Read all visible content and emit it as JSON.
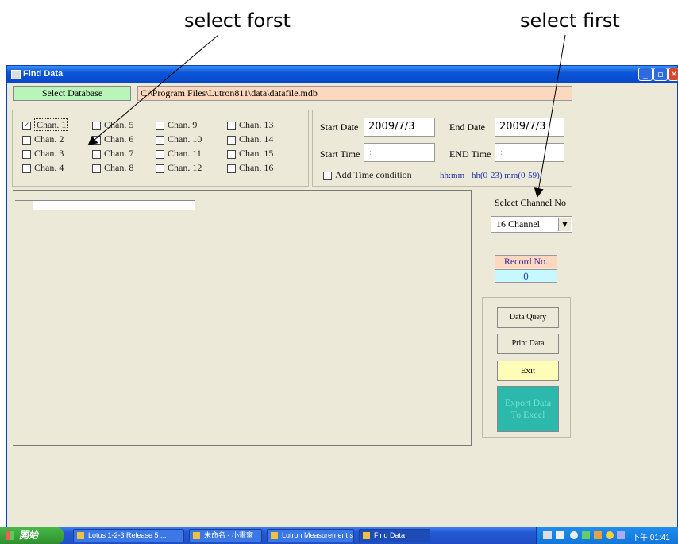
{
  "annotations": {
    "left": "select forst",
    "right": "select first"
  },
  "window": {
    "title": "Find Data",
    "controls": {
      "minimize": "_",
      "maximize": "▫",
      "close": "✕"
    }
  },
  "database": {
    "button_label": "Select Database",
    "path": "C:\\Program Files\\Lutron811\\data\\datafile.mdb"
  },
  "channels": [
    {
      "label": "Chan. 1",
      "checked": true
    },
    {
      "label": "Chan. 2",
      "checked": false
    },
    {
      "label": "Chan. 3",
      "checked": false
    },
    {
      "label": "Chan. 4",
      "checked": false
    },
    {
      "label": "Chan. 5",
      "checked": false
    },
    {
      "label": "Chan. 6",
      "checked": false
    },
    {
      "label": "Chan. 7",
      "checked": false
    },
    {
      "label": "Chan. 8",
      "checked": false
    },
    {
      "label": "Chan. 9",
      "checked": false
    },
    {
      "label": "Chan. 10",
      "checked": false
    },
    {
      "label": "Chan. 11",
      "checked": false
    },
    {
      "label": "Chan. 12",
      "checked": false
    },
    {
      "label": "Chan. 13",
      "checked": false
    },
    {
      "label": "Chan. 14",
      "checked": false
    },
    {
      "label": "Chan. 15",
      "checked": false
    },
    {
      "label": "Chan. 16",
      "checked": false
    }
  ],
  "dates": {
    "start_label": "Start Date",
    "start_value": "2009/7/3",
    "end_label": "End Date",
    "end_value": "2009/7/3",
    "start_time_label": "Start Time",
    "start_time_value": " :",
    "end_time_label": "END Time",
    "end_time_value": " :",
    "add_time_label": "Add Time condition",
    "hint1": "hh:mm",
    "hint2": "hh(0-23) mm(0-59)"
  },
  "select_channel": {
    "label": "Select Channel No",
    "value": "16 Channel"
  },
  "record": {
    "label": "Record No.",
    "value": "0"
  },
  "buttons": {
    "query": "Data Query",
    "print": "Print Data",
    "exit": "Exit",
    "export_line1": "Export Data",
    "export_line2": "To Excel"
  },
  "taskbar": {
    "start": "開始",
    "tasks": [
      "Lotus 1-2-3 Release 5 ...",
      "未命名 - 小畫家",
      "Lutron Measurement s...",
      "Find Data"
    ],
    "clock": "下午 01:41"
  }
}
